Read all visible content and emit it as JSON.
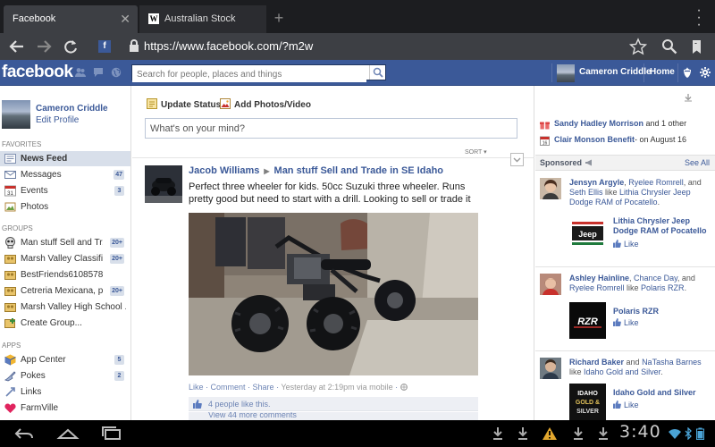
{
  "browser": {
    "tabs": [
      {
        "label": "Facebook",
        "active": true
      },
      {
        "label": "Australian Stock Saddle ...",
        "active": false
      }
    ],
    "url": "https://www.facebook.com/?m2w"
  },
  "fb_header": {
    "logo": "facebook",
    "search_placeholder": "Search for people, places and things",
    "user_name": "Cameron Criddle",
    "home_label": "Home",
    "brand_color": "#3b5998"
  },
  "sidebar": {
    "profile_name": "Cameron Criddle",
    "edit_profile": "Edit Profile",
    "favorites_heading": "FAVORITES",
    "favorites": [
      {
        "label": "News Feed",
        "count": "",
        "icon": "news-feed-icon"
      },
      {
        "label": "Messages",
        "count": "47",
        "icon": "messages-icon"
      },
      {
        "label": "Events",
        "count": "3",
        "icon": "events-icon"
      },
      {
        "label": "Photos",
        "count": "",
        "icon": "photos-icon"
      }
    ],
    "groups_heading": "GROUPS",
    "groups": [
      {
        "label": "Man stuff Sell and Tr...",
        "count": "20+",
        "icon": "skull-icon"
      },
      {
        "label": "Marsh Valley Classifi...",
        "count": "20+",
        "icon": "group-icon"
      },
      {
        "label": "BestFriends61085782",
        "count": "",
        "icon": "group-icon"
      },
      {
        "label": "Cetreria Mexicana, p...",
        "count": "20+",
        "icon": "group-icon"
      },
      {
        "label": "Marsh Valley High School ...",
        "count": "",
        "icon": "group-icon"
      },
      {
        "label": "Create Group...",
        "count": "",
        "icon": "create-group-icon"
      }
    ],
    "apps_heading": "APPS",
    "apps": [
      {
        "label": "App Center",
        "count": "5",
        "icon": "app-center-icon"
      },
      {
        "label": "Pokes",
        "count": "2",
        "icon": "pokes-icon"
      },
      {
        "label": "Links",
        "count": "",
        "icon": "links-icon"
      },
      {
        "label": "FarmVille",
        "count": "",
        "icon": "farmville-icon"
      }
    ]
  },
  "composer": {
    "update_status": "Update Status",
    "add_photos": "Add Photos/Video",
    "placeholder": "What's on your mind?",
    "sort_label": "SORT ▾"
  },
  "post": {
    "author": "Jacob Williams",
    "group": "Man stuff Sell and Trade in SE Idaho",
    "text": "Perfect three wheeler for kids. 50cc Suzuki three wheeler. Runs pretty good but need to start with a drill. Looking to sell or trade it",
    "actions": {
      "like": "Like",
      "comment": "Comment",
      "share": "Share",
      "timestamp": "Yesterday at 2:19pm via mobile"
    },
    "likes_text": "4 people like this.",
    "view_comments": "View 44 more comments"
  },
  "right_column": {
    "events": [
      {
        "bold": "Sandy Hadley Morrison",
        "rest": " and 1 other"
      },
      {
        "bold": "Clair Monson Benefit",
        "rest": "- on August 16"
      }
    ],
    "sponsored_label": "Sponsored",
    "see_all": "See All",
    "ads": [
      {
        "social": [
          {
            "text": "Jensyn Argyle",
            "bold": true
          },
          {
            "text": ", ",
            "bold": false
          },
          {
            "text": "Ryelee Romrell",
            "bold": false,
            "link": true
          },
          {
            "text": ", and ",
            "bold": false
          },
          {
            "text": "Seth Ellis",
            "bold": false,
            "link": true
          },
          {
            "text": " like ",
            "bold": false
          },
          {
            "text": "Lithia Chrysler Jeep Dodge RAM of Pocatello",
            "bold": false,
            "link": true
          },
          {
            "text": ".",
            "bold": false
          }
        ],
        "title": "Lithia Chrysler Jeep Dodge RAM of Pocatello",
        "like": "Like",
        "image_text": "Jeep"
      },
      {
        "social": [
          {
            "text": "Ashley Hainline",
            "bold": true
          },
          {
            "text": ", ",
            "bold": false
          },
          {
            "text": "Chance Day",
            "bold": false,
            "link": true
          },
          {
            "text": ", and ",
            "bold": false
          },
          {
            "text": "Ryelee Romrell",
            "bold": false,
            "link": true
          },
          {
            "text": " like ",
            "bold": false
          },
          {
            "text": "Polaris RZR",
            "bold": false,
            "link": true
          },
          {
            "text": ".",
            "bold": false
          }
        ],
        "title": "Polaris RZR",
        "like": "Like",
        "image_text": "RZR"
      },
      {
        "social": [
          {
            "text": "Richard Baker",
            "bold": true
          },
          {
            "text": " and ",
            "bold": false
          },
          {
            "text": "NaTasha Barnes",
            "bold": false,
            "link": true
          },
          {
            "text": " like ",
            "bold": false
          },
          {
            "text": "Idaho Gold and Silver",
            "bold": false,
            "link": true
          },
          {
            "text": ".",
            "bold": false
          }
        ],
        "title": "Idaho Gold and Silver",
        "like": "Like",
        "image_text": "IDAHO GOLD & SILVER"
      }
    ]
  },
  "system_bar": {
    "clock": "3:40"
  }
}
